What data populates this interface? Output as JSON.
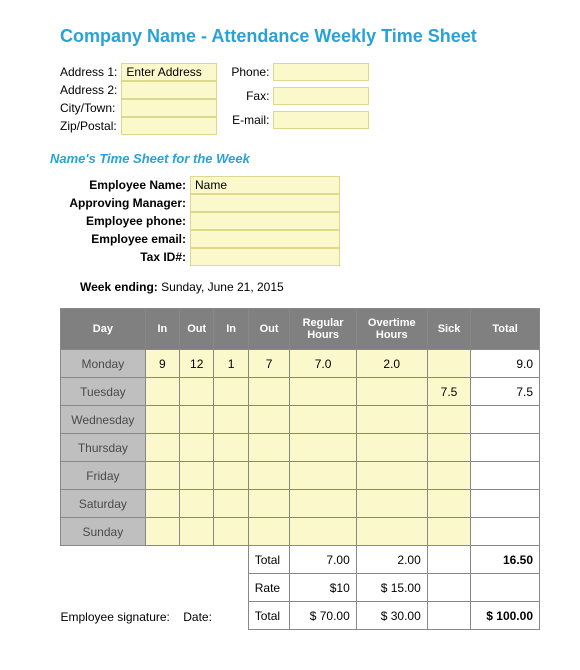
{
  "title": "Company Name - Attendance Weekly Time Sheet",
  "address_labels": {
    "addr1": "Address 1:",
    "addr2": "Address 2:",
    "city": "City/Town:",
    "zip": "Zip/Postal:",
    "phone": "Phone:",
    "fax": "Fax:",
    "email": "E-mail:"
  },
  "address_values": {
    "addr1": "Enter Address",
    "addr2": "",
    "city": "",
    "zip": "",
    "phone": "",
    "fax": "",
    "email": ""
  },
  "subheader": "Name's Time Sheet for the Week",
  "employee_labels": {
    "name": "Employee Name:",
    "manager": "Approving Manager:",
    "phone": "Employee phone:",
    "email": "Employee email:",
    "taxid": "Tax ID#:"
  },
  "employee_values": {
    "name": "Name",
    "manager": "",
    "phone": "",
    "email": "",
    "taxid": ""
  },
  "week_ending_label": "Week ending:",
  "week_ending_value": "Sunday, June 21, 2015",
  "table": {
    "headers": {
      "day": "Day",
      "in1": "In",
      "out1": "Out",
      "in2": "In",
      "out2": "Out",
      "regular": "Regular Hours",
      "overtime": "Overtime Hours",
      "sick": "Sick",
      "total": "Total"
    },
    "rows": [
      {
        "day": "Monday",
        "in1": "9",
        "out1": "12",
        "in2": "1",
        "out2": "7",
        "regular": "7.0",
        "overtime": "2.0",
        "sick": "",
        "total": "9.0"
      },
      {
        "day": "Tuesday",
        "in1": "",
        "out1": "",
        "in2": "",
        "out2": "",
        "regular": "",
        "overtime": "",
        "sick": "7.5",
        "total": "7.5"
      },
      {
        "day": "Wednesday",
        "in1": "",
        "out1": "",
        "in2": "",
        "out2": "",
        "regular": "",
        "overtime": "",
        "sick": "",
        "total": ""
      },
      {
        "day": "Thursday",
        "in1": "",
        "out1": "",
        "in2": "",
        "out2": "",
        "regular": "",
        "overtime": "",
        "sick": "",
        "total": ""
      },
      {
        "day": "Friday",
        "in1": "",
        "out1": "",
        "in2": "",
        "out2": "",
        "regular": "",
        "overtime": "",
        "sick": "",
        "total": ""
      },
      {
        "day": "Saturday",
        "in1": "",
        "out1": "",
        "in2": "",
        "out2": "",
        "regular": "",
        "overtime": "",
        "sick": "",
        "total": ""
      },
      {
        "day": "Sunday",
        "in1": "",
        "out1": "",
        "in2": "",
        "out2": "",
        "regular": "",
        "overtime": "",
        "sick": "",
        "total": ""
      }
    ],
    "summary": {
      "total_label": "Total",
      "rate_label": "Rate",
      "total2_label": "Total",
      "reg_total": "7.00",
      "ot_total": "2.00",
      "grand_total": "16.50",
      "reg_rate": "$10",
      "ot_rate": "$    15.00",
      "reg_cost": "$  70.00",
      "ot_cost": "$    30.00",
      "grand_cost": "$  100.00"
    }
  },
  "signature": {
    "emp_sig": "Employee signature:",
    "date": "Date:"
  },
  "chart_data": {
    "type": "table",
    "title": "Attendance Weekly Time Sheet",
    "week_ending": "Sunday, June 21, 2015",
    "columns": [
      "Day",
      "In",
      "Out",
      "In",
      "Out",
      "Regular Hours",
      "Overtime Hours",
      "Sick",
      "Total"
    ],
    "rows": [
      [
        "Monday",
        9,
        12,
        1,
        7,
        7.0,
        2.0,
        null,
        9.0
      ],
      [
        "Tuesday",
        null,
        null,
        null,
        null,
        null,
        null,
        7.5,
        7.5
      ],
      [
        "Wednesday",
        null,
        null,
        null,
        null,
        null,
        null,
        null,
        null
      ],
      [
        "Thursday",
        null,
        null,
        null,
        null,
        null,
        null,
        null,
        null
      ],
      [
        "Friday",
        null,
        null,
        null,
        null,
        null,
        null,
        null,
        null
      ],
      [
        "Saturday",
        null,
        null,
        null,
        null,
        null,
        null,
        null,
        null
      ],
      [
        "Sunday",
        null,
        null,
        null,
        null,
        null,
        null,
        null,
        null
      ]
    ],
    "totals": {
      "regular_hours": 7.0,
      "overtime_hours": 2.0,
      "grand_total_hours": 16.5
    },
    "rates": {
      "regular": 10,
      "overtime": 15.0
    },
    "costs": {
      "regular": 70.0,
      "overtime": 30.0,
      "grand_total": 100.0
    }
  }
}
